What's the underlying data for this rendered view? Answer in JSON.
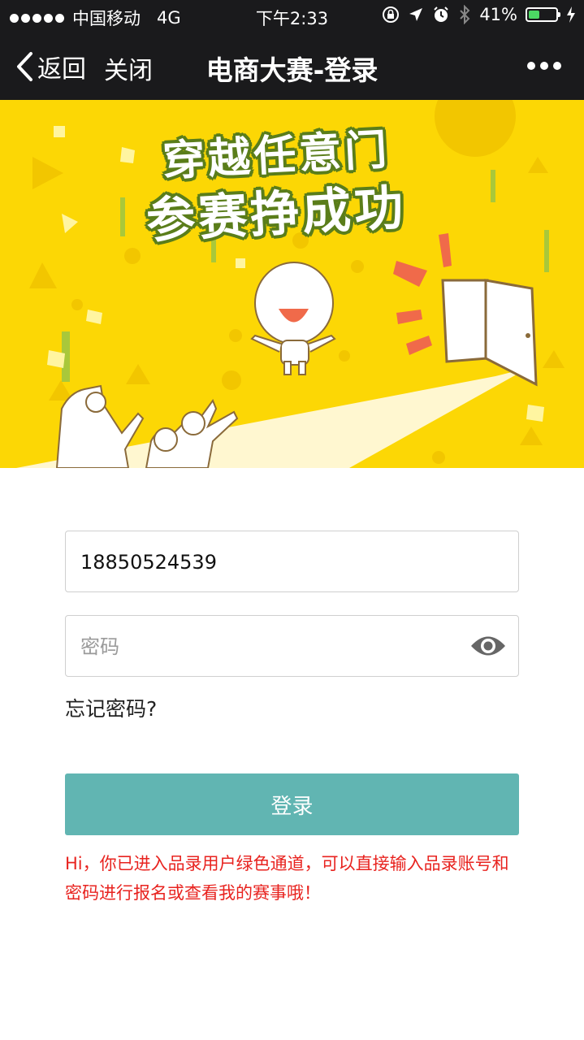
{
  "status_bar": {
    "carrier": "中国移动",
    "network": "4G",
    "time": "下午2:33",
    "battery_text": "41%",
    "battery_level": 0.41,
    "battery_color": "#4cd964"
  },
  "nav": {
    "back_label": "返回",
    "close_label": "关闭",
    "title": "电商大赛-登录"
  },
  "banner": {
    "line1": "穿越任意门",
    "line2": "参赛挣成功",
    "background_color": "#fcd705"
  },
  "form": {
    "phone_value": "18850524539",
    "password_placeholder": "密码",
    "forgot_label": "忘记密码?",
    "login_label": "登录",
    "login_color": "#61b5b2"
  },
  "notice": {
    "text": "Hi，你已进入品录用户绿色通道，可以直接输入品录账号和密码进行报名或查看我的赛事哦！",
    "color": "#e8231f"
  },
  "icons": {
    "back": "chevron-left-icon",
    "more": "more-dots-icon",
    "eye": "eye-icon",
    "lock_rotation": "lock-rotation-icon",
    "location": "location-arrow-icon",
    "alarm": "alarm-icon",
    "bluetooth": "bluetooth-icon",
    "charging": "bolt-icon"
  }
}
